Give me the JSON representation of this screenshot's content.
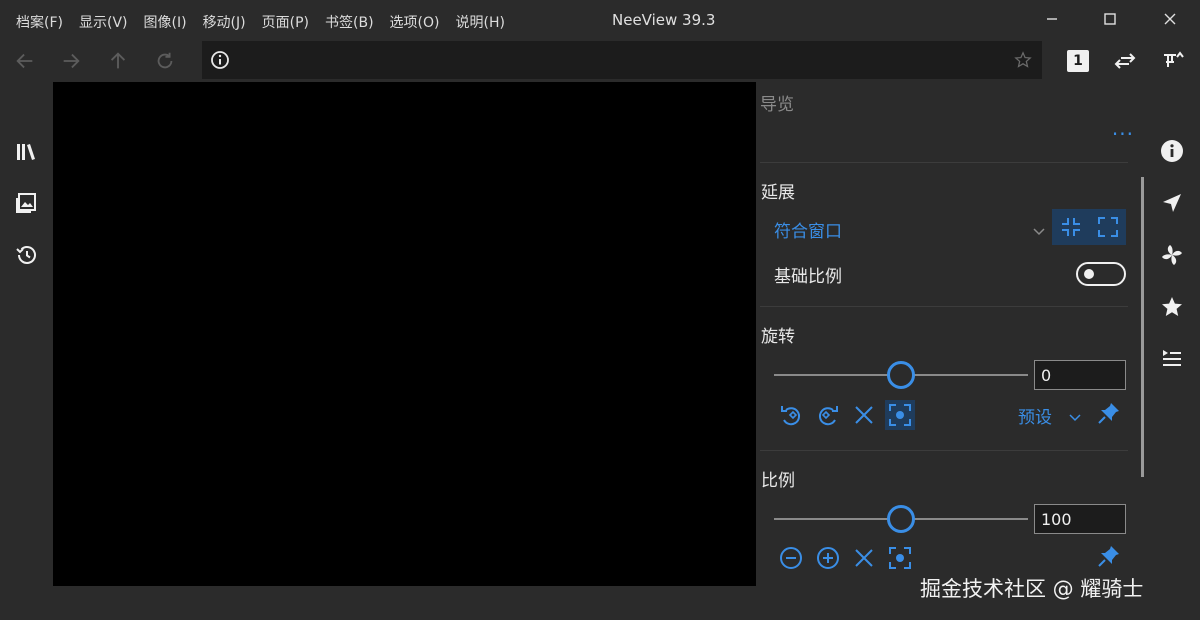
{
  "window": {
    "title": "NeeView 39.3",
    "menu": [
      "档案(F)",
      "显示(V)",
      "图像(I)",
      "移动(J)",
      "页面(P)",
      "书签(B)",
      "选项(O)",
      "说明(H)"
    ],
    "controls": [
      "minimize-icon",
      "maximize-icon",
      "close-icon"
    ]
  },
  "toolbar": {
    "nav_icons": [
      "back-arrow-icon",
      "forward-arrow-icon",
      "up-arrow-icon",
      "refresh-icon"
    ],
    "address_value": "",
    "page_mode_label": "1",
    "right_icons": [
      "page-direction-icon",
      "pin-menu-icon"
    ]
  },
  "left_sidebar": {
    "icons": [
      "bookshelf-icon",
      "page-list-icon",
      "history-icon"
    ]
  },
  "navigator": {
    "title": "导览",
    "more_label": "···",
    "stretch": {
      "title": "延展",
      "selected": "符合窗口",
      "base_scale_label": "基础比例",
      "base_scale_on": false
    },
    "rotate": {
      "title": "旋转",
      "value": "0",
      "level": 0.5,
      "preset_label": "预设",
      "button_icons": [
        "rotate-left-icon",
        "rotate-right-icon",
        "reset-x-icon",
        "rotate-fit-icon",
        "pin-icon"
      ]
    },
    "scale": {
      "title": "比例",
      "value": "100",
      "level": 0.5,
      "button_icons": [
        "zoom-out-icon",
        "zoom-in-icon",
        "reset-x-icon",
        "scale-fit-icon",
        "pin-icon"
      ]
    }
  },
  "right_sidebar": {
    "icons": [
      "info-icon",
      "navigator-icon",
      "effect-icon",
      "favorite-star-icon",
      "playlist-icon"
    ]
  },
  "watermark": "掘金技术社区 @ 耀骑士",
  "colors": {
    "accent": "#3a8ee6",
    "background": "#2b2b2b",
    "viewer": "#000000"
  }
}
